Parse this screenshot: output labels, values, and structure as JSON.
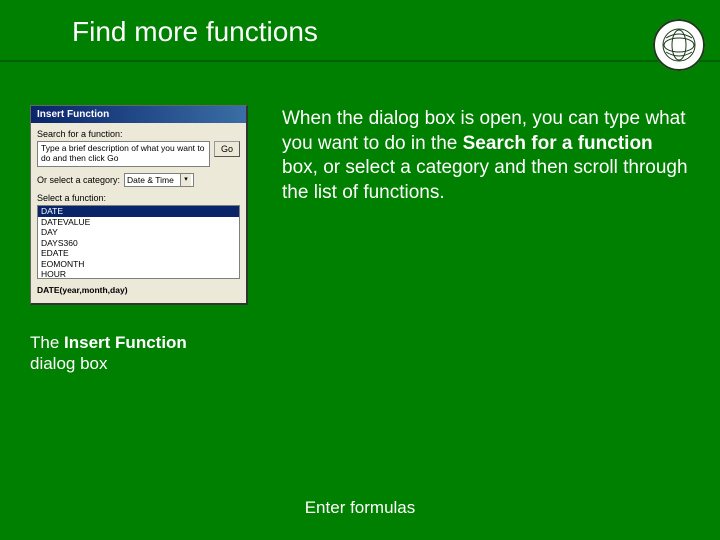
{
  "title": "Find more functions",
  "logo_alt": "institute-seal",
  "dialog": {
    "title": "Insert Function",
    "search_label": "Search for a function:",
    "search_placeholder": "Type a brief description of what you want to do and then click Go",
    "go_label": "Go",
    "category_label": "Or select a category:",
    "category_value": "Date & Time",
    "select_label": "Select a function:",
    "functions": {
      "f0": "DATE",
      "f1": "DATEVALUE",
      "f2": "DAY",
      "f3": "DAYS360",
      "f4": "EDATE",
      "f5": "EOMONTH",
      "f6": "HOUR"
    },
    "signature": "DATE(year,month,day)"
  },
  "explain_pre": "When the dialog box is open, you can type what you want to do in the ",
  "explain_bold": "Search for a function",
  "explain_post": " box, or select a category and then scroll through the list of functions.",
  "caption_pre": "The ",
  "caption_bold": "Insert Function",
  "caption_post": " dialog box",
  "footer": "Enter formulas"
}
